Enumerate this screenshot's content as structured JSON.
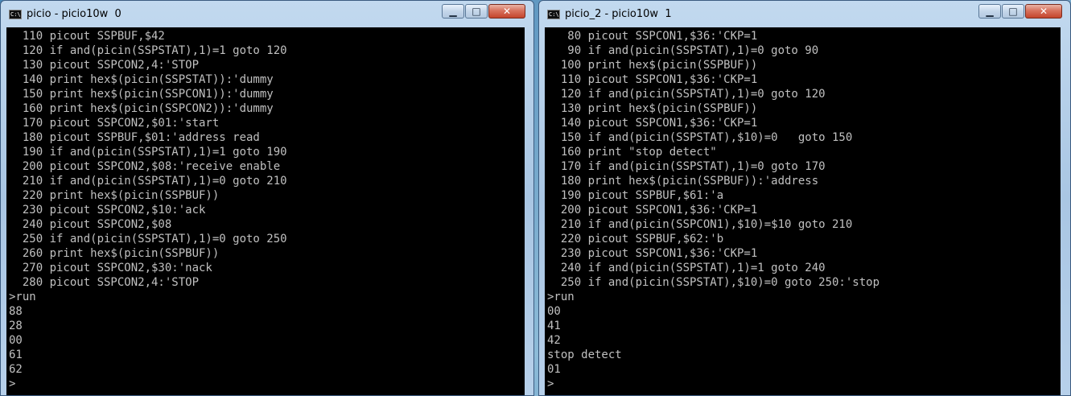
{
  "window1": {
    "title": "picio - picio10w  0",
    "icon_text": "C:\\",
    "minimize": "▁",
    "maximize": "□",
    "close": "✕",
    "lines": [
      "  110 picout SSPBUF,$42",
      "  120 if and(picin(SSPSTAT),1)=1 goto 120",
      "  130 picout SSPCON2,4:'STOP",
      "  140 print hex$(picin(SSPSTAT)):'dummy",
      "  150 print hex$(picin(SSPCON1)):'dummy",
      "  160 print hex$(picin(SSPCON2)):'dummy",
      "  170 picout SSPCON2,$01:'start",
      "  180 picout SSPBUF,$01:'address read",
      "  190 if and(picin(SSPSTAT),1)=1 goto 190",
      "  200 picout SSPCON2,$08:'receive enable",
      "  210 if and(picin(SSPSTAT),1)=0 goto 210",
      "  220 print hex$(picin(SSPBUF))",
      "  230 picout SSPCON2,$10:'ack",
      "  240 picout SSPCON2,$08",
      "  250 if and(picin(SSPSTAT),1)=0 goto 250",
      "  260 print hex$(picin(SSPBUF))",
      "  270 picout SSPCON2,$30:'nack",
      "  280 picout SSPCON2,4:'STOP",
      ">run",
      "88",
      "28",
      "00",
      "61",
      "62",
      ">"
    ]
  },
  "window2": {
    "title": "picio_2 - picio10w  1",
    "icon_text": "C:\\",
    "minimize": "▁",
    "maximize": "□",
    "close": "✕",
    "lines": [
      "   80 picout SSPCON1,$36:'CKP=1",
      "   90 if and(picin(SSPSTAT),1)=0 goto 90",
      "  100 print hex$(picin(SSPBUF))",
      "  110 picout SSPCON1,$36:'CKP=1",
      "  120 if and(picin(SSPSTAT),1)=0 goto 120",
      "  130 print hex$(picin(SSPBUF))",
      "  140 picout SSPCON1,$36:'CKP=1",
      "  150 if and(picin(SSPSTAT),$10)=0   goto 150",
      "  160 print \"stop detect\"",
      "  170 if and(picin(SSPSTAT),1)=0 goto 170",
      "  180 print hex$(picin(SSPBUF)):'address",
      "  190 picout SSPBUF,$61:'a",
      "  200 picout SSPCON1,$36:'CKP=1",
      "  210 if and(picin(SSPCON1),$10)=$10 goto 210",
      "  220 picout SSPBUF,$62:'b",
      "  230 picout SSPCON1,$36:'CKP=1",
      "  240 if and(picin(SSPSTAT),1)=1 goto 240",
      "  250 if and(picin(SSPSTAT),$10)=0 goto 250:'stop",
      ">run",
      "00",
      "41",
      "42",
      "stop detect",
      "01",
      ">"
    ]
  }
}
